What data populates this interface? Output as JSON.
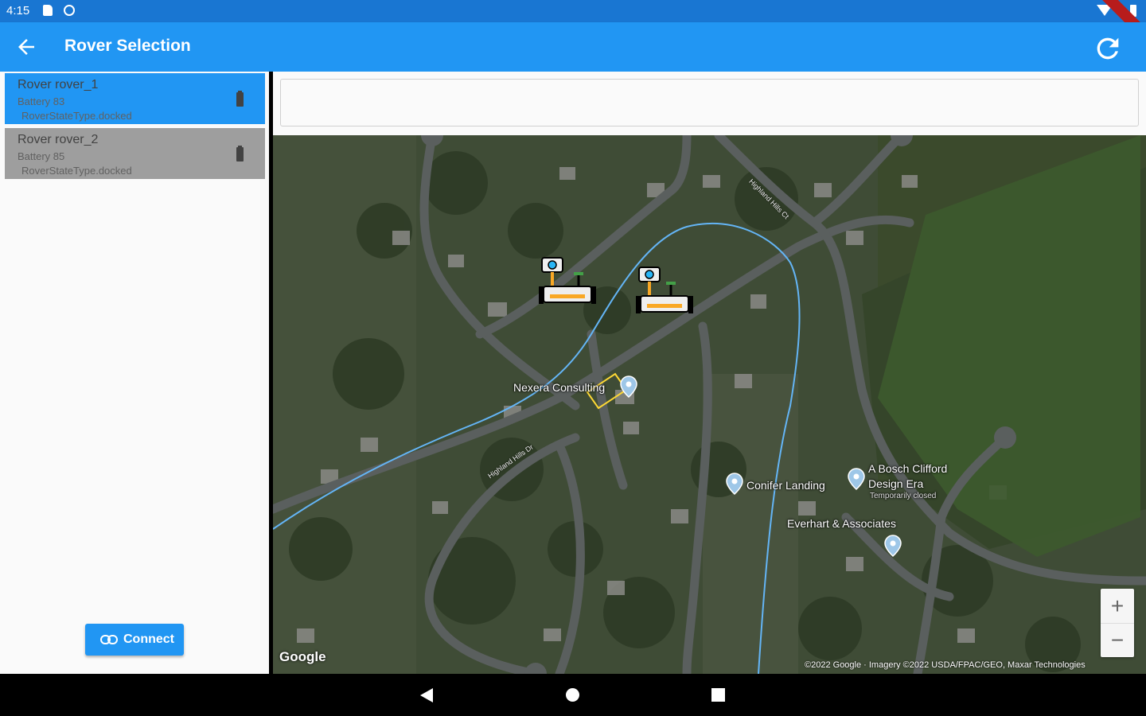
{
  "status_bar": {
    "time": "4:15"
  },
  "app_bar": {
    "title": "Rover Selection"
  },
  "rovers": [
    {
      "name": "Rover rover_1",
      "battery": "Battery 83",
      "state": "RoverStateType.docked",
      "selected": true
    },
    {
      "name": "Rover rover_2",
      "battery": "Battery 85",
      "state": "RoverStateType.docked",
      "selected": false
    }
  ],
  "connect_button": {
    "label": "Connect"
  },
  "info_box": {
    "text": ""
  },
  "map": {
    "labels": {
      "nexera": "Nexera Consulting",
      "conifer": "Conifer Landing",
      "bosch": "A Bosch Clifford",
      "bosch_sub": "Design Era",
      "bosch_status": "Temporarily closed",
      "everhart": "Everhart & Associates"
    },
    "road_labels": {
      "highland_1": "Highland Hills Ct",
      "highland_2": "Highland Hills Dr"
    },
    "zoom_in": "+",
    "zoom_out": "−",
    "logo": "Google",
    "copyright": "©2022 Google · Imagery ©2022 USDA/FPAC/GEO, Maxar Technologies"
  },
  "colors": {
    "primary": "#2196f3",
    "status_bar": "#1976d2",
    "selected_card": "#2196f3",
    "unselected_card": "#9e9e9e",
    "route_line": "#64b5f6"
  }
}
